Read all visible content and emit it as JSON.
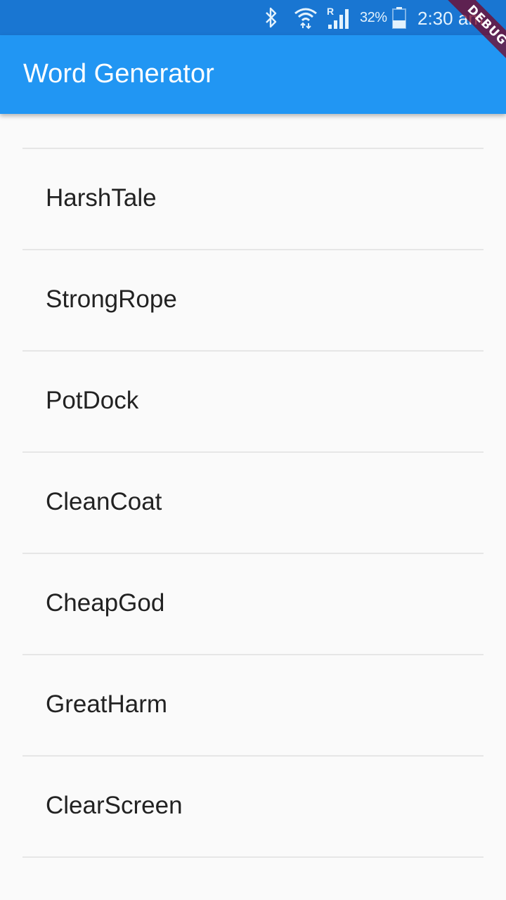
{
  "status_bar": {
    "battery_percent": "32%",
    "time": "2:30 am",
    "icons": [
      "bluetooth-icon",
      "wifi-icon",
      "cell-signal-icon",
      "battery-icon"
    ]
  },
  "app_bar": {
    "title": "Word Generator"
  },
  "debug_banner": {
    "label": "DEBUG"
  },
  "word_list": {
    "items": [
      "HarshTale",
      "StrongRope",
      "PotDock",
      "CleanCoat",
      "CheapGod",
      "GreatHarm",
      "ClearScreen"
    ]
  },
  "colors": {
    "status_bar": "#1976d2",
    "app_bar": "#2196f3",
    "background": "#fafafa",
    "divider": "#e6e6e6",
    "text": "#222222"
  }
}
